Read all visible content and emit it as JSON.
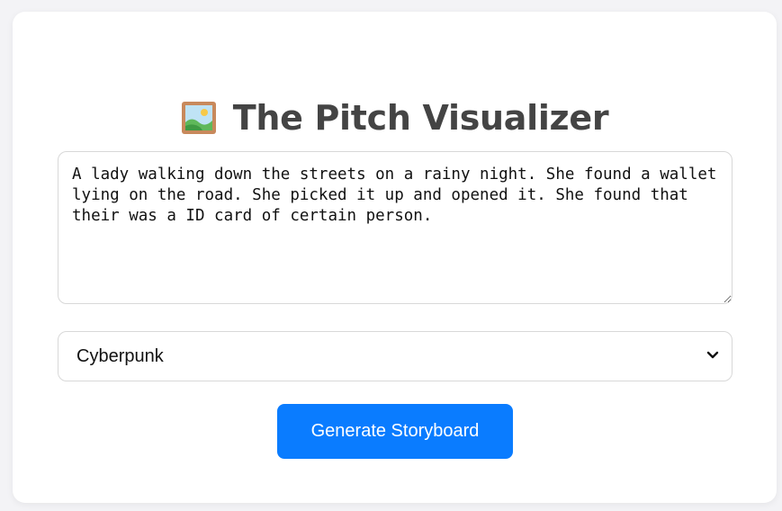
{
  "app": {
    "title": "The Pitch Visualizer",
    "title_icon": "framed-picture-icon"
  },
  "story": {
    "value": "A lady walking down the streets on a rainy night. She found a wallet lying on the road. She picked it up and opened it. She found that their was a ID card of certain person."
  },
  "style_select": {
    "selected": "Cyberpunk"
  },
  "actions": {
    "generate_label": "Generate Storyboard"
  },
  "colors": {
    "background": "#f3f3f6",
    "card": "#ffffff",
    "title_text": "#444444",
    "button_bg": "#0a7cff",
    "button_text": "#ffffff",
    "border": "#d8d8d8"
  }
}
